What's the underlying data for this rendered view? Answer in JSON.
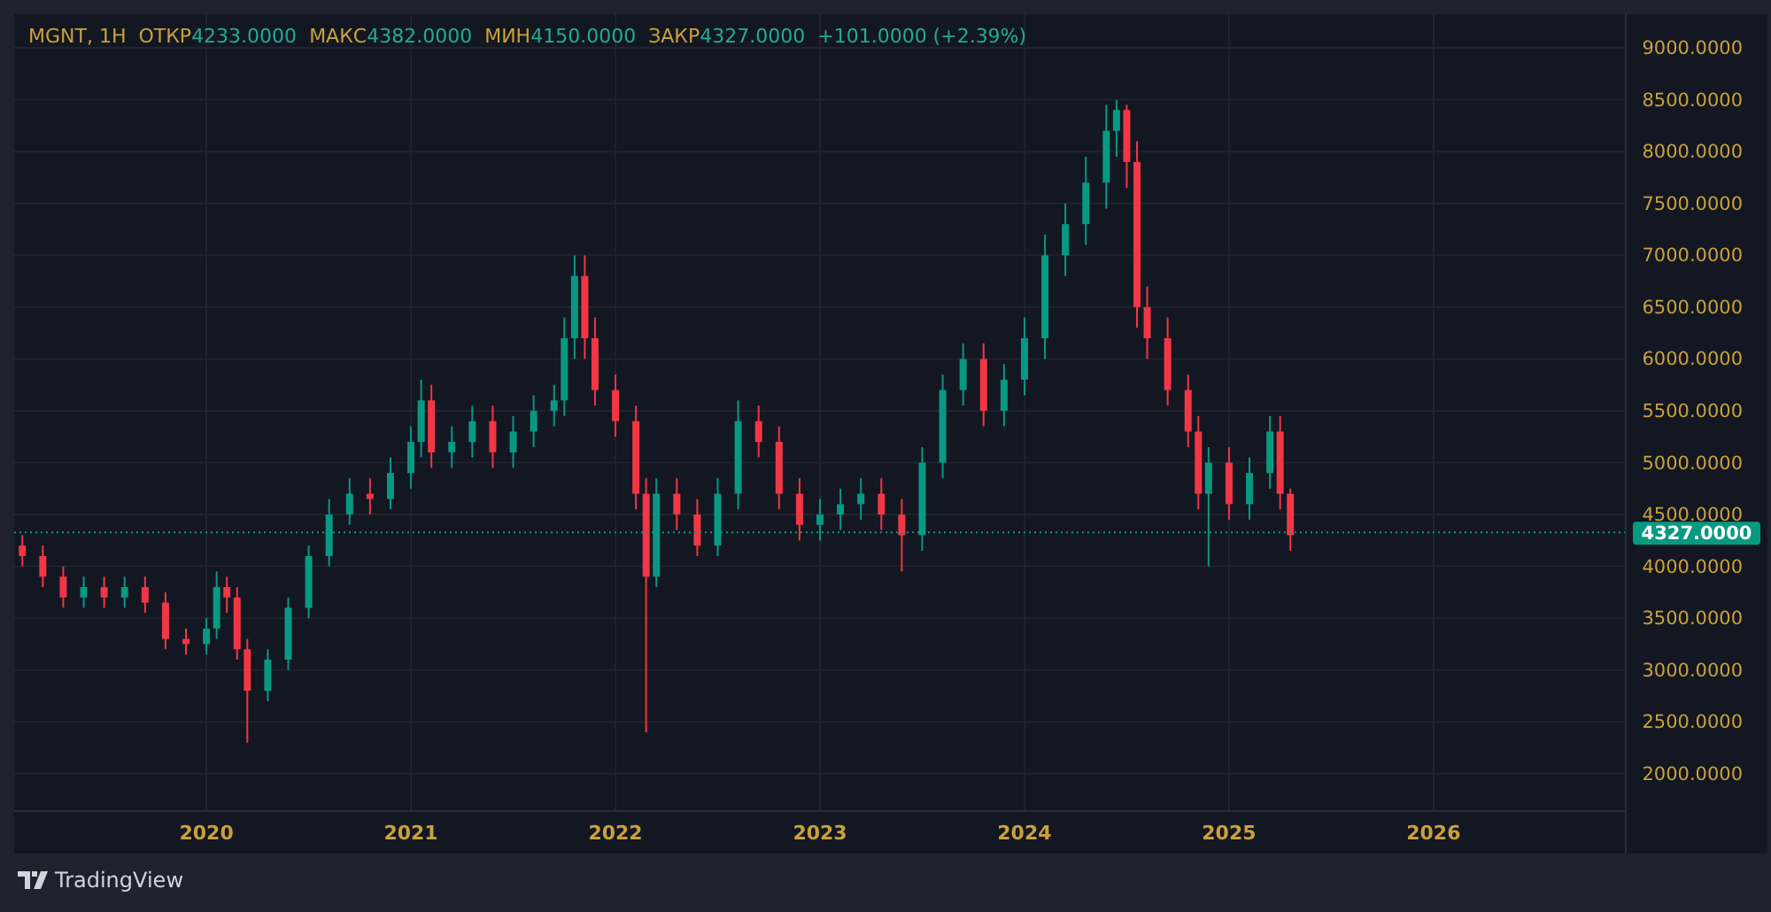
{
  "legend": {
    "symbol": "MGNT, 1H",
    "stats": [
      {
        "label": "ОТКР",
        "value": "4233.0000"
      },
      {
        "label": "МАКС",
        "value": "4382.0000"
      },
      {
        "label": "МИН",
        "value": "4150.0000"
      },
      {
        "label": "ЗАКР",
        "value": "4327.0000"
      }
    ],
    "change": "+101.0000 (+2.39%)"
  },
  "chart_data": {
    "type": "candlestick",
    "grid": true,
    "ylim": [
      1640,
      9325
    ],
    "xlim": [
      2019.06,
      2026.94
    ],
    "yticks": [
      {
        "value": 9000,
        "label": "9000.0000"
      },
      {
        "value": 8500,
        "label": "8500.0000"
      },
      {
        "value": 8000,
        "label": "8000.0000"
      },
      {
        "value": 7500,
        "label": "7500.0000"
      },
      {
        "value": 7000,
        "label": "7000.0000"
      },
      {
        "value": 6500,
        "label": "6500.0000"
      },
      {
        "value": 6000,
        "label": "6000.0000"
      },
      {
        "value": 5500,
        "label": "5500.0000"
      },
      {
        "value": 5000,
        "label": "5000.0000"
      },
      {
        "value": 4500,
        "label": "4500.0000"
      },
      {
        "value": 4000,
        "label": "4000.0000"
      },
      {
        "value": 3500,
        "label": "3500.0000"
      },
      {
        "value": 3000,
        "label": "3000.0000"
      },
      {
        "value": 2500,
        "label": "2500.0000"
      },
      {
        "value": 2000,
        "label": "2000.0000"
      }
    ],
    "xticks": [
      {
        "value": 2020,
        "label": "2020"
      },
      {
        "value": 2021,
        "label": "2021"
      },
      {
        "value": 2022,
        "label": "2022"
      },
      {
        "value": 2023,
        "label": "2023"
      },
      {
        "value": 2024,
        "label": "2024"
      },
      {
        "value": 2025,
        "label": "2025"
      },
      {
        "value": 2026,
        "label": "2026"
      }
    ],
    "x": [
      2019.1,
      2019.2,
      2019.3,
      2019.4,
      2019.5,
      2019.6,
      2019.7,
      2019.8,
      2019.9,
      2020.0,
      2020.05,
      2020.1,
      2020.15,
      2020.2,
      2020.3,
      2020.4,
      2020.5,
      2020.6,
      2020.7,
      2020.8,
      2020.9,
      2021.0,
      2021.05,
      2021.1,
      2021.2,
      2021.3,
      2021.4,
      2021.5,
      2021.6,
      2021.7,
      2021.75,
      2021.8,
      2021.85,
      2021.9,
      2022.0,
      2022.1,
      2022.15,
      2022.2,
      2022.3,
      2022.4,
      2022.5,
      2022.6,
      2022.7,
      2022.8,
      2022.9,
      2023.0,
      2023.1,
      2023.2,
      2023.3,
      2023.4,
      2023.5,
      2023.6,
      2023.7,
      2023.8,
      2023.9,
      2024.0,
      2024.1,
      2024.2,
      2024.3,
      2024.4,
      2024.45,
      2024.5,
      2024.55,
      2024.6,
      2024.7,
      2024.8,
      2024.85,
      2024.9,
      2025.0,
      2025.1,
      2025.2,
      2025.25,
      2025.3
    ],
    "ohlc": [
      [
        4200,
        4300,
        4000,
        4100
      ],
      [
        4100,
        4200,
        3800,
        3900
      ],
      [
        3900,
        4000,
        3600,
        3700
      ],
      [
        3700,
        3900,
        3600,
        3800
      ],
      [
        3800,
        3900,
        3600,
        3700
      ],
      [
        3700,
        3900,
        3600,
        3800
      ],
      [
        3800,
        3900,
        3550,
        3650
      ],
      [
        3650,
        3750,
        3200,
        3300
      ],
      [
        3300,
        3400,
        3150,
        3250
      ],
      [
        3250,
        3500,
        3150,
        3400
      ],
      [
        3400,
        3950,
        3300,
        3800
      ],
      [
        3800,
        3900,
        3550,
        3700
      ],
      [
        3700,
        3800,
        3100,
        3200
      ],
      [
        3200,
        3300,
        2300,
        2800
      ],
      [
        2800,
        3200,
        2700,
        3100
      ],
      [
        3100,
        3700,
        3000,
        3600
      ],
      [
        3600,
        4200,
        3500,
        4100
      ],
      [
        4100,
        4650,
        4000,
        4500
      ],
      [
        4500,
        4850,
        4400,
        4700
      ],
      [
        4700,
        4850,
        4500,
        4650
      ],
      [
        4650,
        5050,
        4550,
        4900
      ],
      [
        4900,
        5350,
        4750,
        5200
      ],
      [
        5200,
        5800,
        5050,
        5600
      ],
      [
        5600,
        5750,
        4950,
        5100
      ],
      [
        5100,
        5350,
        4950,
        5200
      ],
      [
        5200,
        5550,
        5050,
        5400
      ],
      [
        5400,
        5550,
        4950,
        5100
      ],
      [
        5100,
        5450,
        4950,
        5300
      ],
      [
        5300,
        5650,
        5150,
        5500
      ],
      [
        5500,
        5750,
        5350,
        5600
      ],
      [
        5600,
        6400,
        5450,
        6200
      ],
      [
        6200,
        7000,
        6000,
        6800
      ],
      [
        6800,
        7000,
        6000,
        6200
      ],
      [
        6200,
        6400,
        5550,
        5700
      ],
      [
        5700,
        5850,
        5250,
        5400
      ],
      [
        5400,
        5550,
        4550,
        4700
      ],
      [
        4700,
        4850,
        2400,
        3900
      ],
      [
        3900,
        4850,
        3800,
        4700
      ],
      [
        4700,
        4850,
        4350,
        4500
      ],
      [
        4500,
        4650,
        4100,
        4200
      ],
      [
        4200,
        4850,
        4100,
        4700
      ],
      [
        4700,
        5600,
        4550,
        5400
      ],
      [
        5400,
        5550,
        5050,
        5200
      ],
      [
        5200,
        5350,
        4550,
        4700
      ],
      [
        4700,
        4850,
        4250,
        4400
      ],
      [
        4400,
        4650,
        4250,
        4500
      ],
      [
        4500,
        4750,
        4350,
        4600
      ],
      [
        4600,
        4850,
        4450,
        4700
      ],
      [
        4700,
        4850,
        4350,
        4500
      ],
      [
        4500,
        4650,
        3950,
        4300
      ],
      [
        4300,
        5150,
        4150,
        5000
      ],
      [
        5000,
        5850,
        4850,
        5700
      ],
      [
        5700,
        6150,
        5550,
        6000
      ],
      [
        6000,
        6150,
        5350,
        5500
      ],
      [
        5500,
        5950,
        5350,
        5800
      ],
      [
        5800,
        6400,
        5650,
        6200
      ],
      [
        6200,
        7200,
        6000,
        7000
      ],
      [
        7000,
        7500,
        6800,
        7300
      ],
      [
        7300,
        7950,
        7100,
        7700
      ],
      [
        7700,
        8450,
        7450,
        8200
      ],
      [
        8200,
        8500,
        7950,
        8400
      ],
      [
        8400,
        8450,
        7650,
        7900
      ],
      [
        7900,
        8100,
        6300,
        6500
      ],
      [
        6500,
        6700,
        6000,
        6200
      ],
      [
        6200,
        6400,
        5550,
        5700
      ],
      [
        5700,
        5850,
        5150,
        5300
      ],
      [
        5300,
        5450,
        4550,
        4700
      ],
      [
        4700,
        5150,
        4000,
        5000
      ],
      [
        5000,
        5150,
        4450,
        4600
      ],
      [
        4600,
        5050,
        4450,
        4900
      ],
      [
        4900,
        5450,
        4750,
        5300
      ],
      [
        5300,
        5450,
        4550,
        4700
      ],
      [
        4700,
        4750,
        4150,
        4300
      ]
    ],
    "ref_lines": [
      {
        "axis": "y",
        "value": 4327,
        "color": "#089981",
        "label": "4327.0000"
      }
    ]
  },
  "brand": "TradingView"
}
